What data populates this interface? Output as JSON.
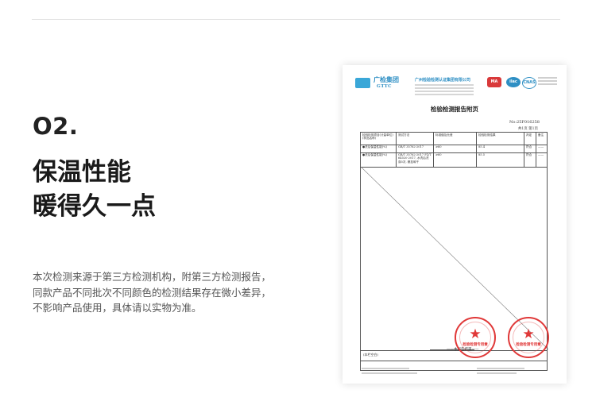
{
  "section": {
    "number": "O2.",
    "headline_line1": "保温性能",
    "headline_line2": "暖得久一点"
  },
  "description": {
    "line1": "本次检测来源于第三方检测机构，附第三方检测报告，",
    "line2": "同款产品不同批次不同颜色的检测结果存在微小差异，",
    "line3": "不影响产品使用，具体请以实物为准。"
  },
  "report": {
    "logo_name": "广检集团",
    "logo_sub": "GTTC",
    "org_name": "广州检验检测认证集团有限公司",
    "cert_ma": "MA",
    "cert_ilac": "ilac-MRA",
    "cert_cnas": "CNAS",
    "title": "检验检测报告附页",
    "report_no": "No:25F016258",
    "page_info": "共1页  第1页",
    "table_headers": [
      "检验检测项目(计量单位)(样品名称)",
      "测试方法",
      "标准值及允差",
      "检验检测结果",
      "判定",
      "备注"
    ],
    "rows": [
      [
        "●洗后保温性能(%)",
        "GB/T 35762-2017",
        "≥60",
        "85.4",
        "符合",
        "——"
      ],
      [
        "●洗后保温性能(%)",
        "GB/T 35762-2017 FZ/T 64020-2017, 水洗后洗涤5次, 悬挂晾干",
        "≥60",
        "85.5",
        "符合",
        "——"
      ]
    ],
    "note": "(本栏空白)",
    "end_text": "——本报告结束——",
    "stamp_text_1": "检验检测专用章",
    "stamp_text_2": "检验检测专用章"
  }
}
